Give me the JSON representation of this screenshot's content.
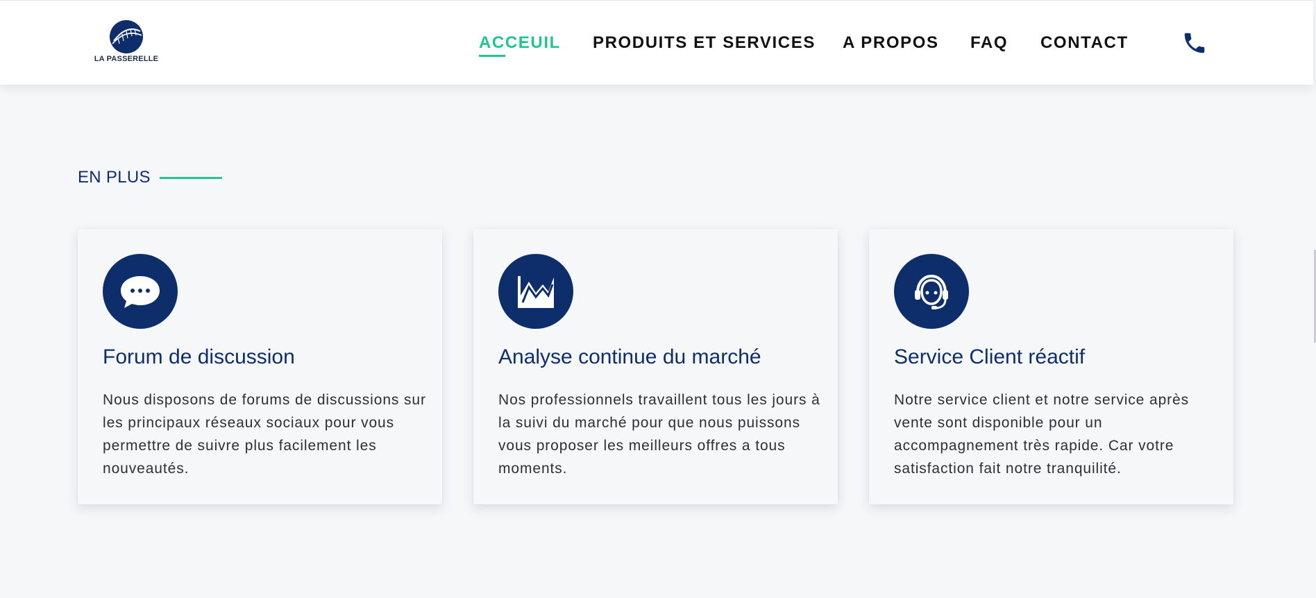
{
  "brand": {
    "name": "LA PASSERELLE",
    "logo_icon": "bridge-logo-icon"
  },
  "nav": {
    "items": [
      {
        "label": "ACCEUIL",
        "active": true
      },
      {
        "label": "PRODUITS ET SERVICES",
        "active": false
      },
      {
        "label": "A PROPOS",
        "active": false
      },
      {
        "label": "FAQ",
        "active": false
      },
      {
        "label": "CONTACT",
        "active": false
      }
    ],
    "phone_icon": "phone-icon"
  },
  "section": {
    "label": "EN PLUS"
  },
  "cards": [
    {
      "icon": "chat-bubble-icon",
      "title": "Forum de discussion",
      "text": "Nous disposons de forums de discussions sur les principaux réseaux sociaux pour vous permettre de suivre plus facilement les nouveautés."
    },
    {
      "icon": "chart-line-icon",
      "title": "Analyse continue du marché",
      "text": "Nos professionnels travaillent tous les jours à la suivi du marché pour que nous puissons vous proposer les meilleurs offres a tous moments."
    },
    {
      "icon": "customer-support-icon",
      "title": "Service Client réactif",
      "text": "Notre service client et notre service après vente sont disponible pour un accompagnement très rapide. Car votre satisfaction fait notre tranquilité."
    }
  ],
  "colors": {
    "accent": "#1fc68f",
    "brand_navy": "#0d2d6b",
    "background": "#f6f7f9"
  }
}
